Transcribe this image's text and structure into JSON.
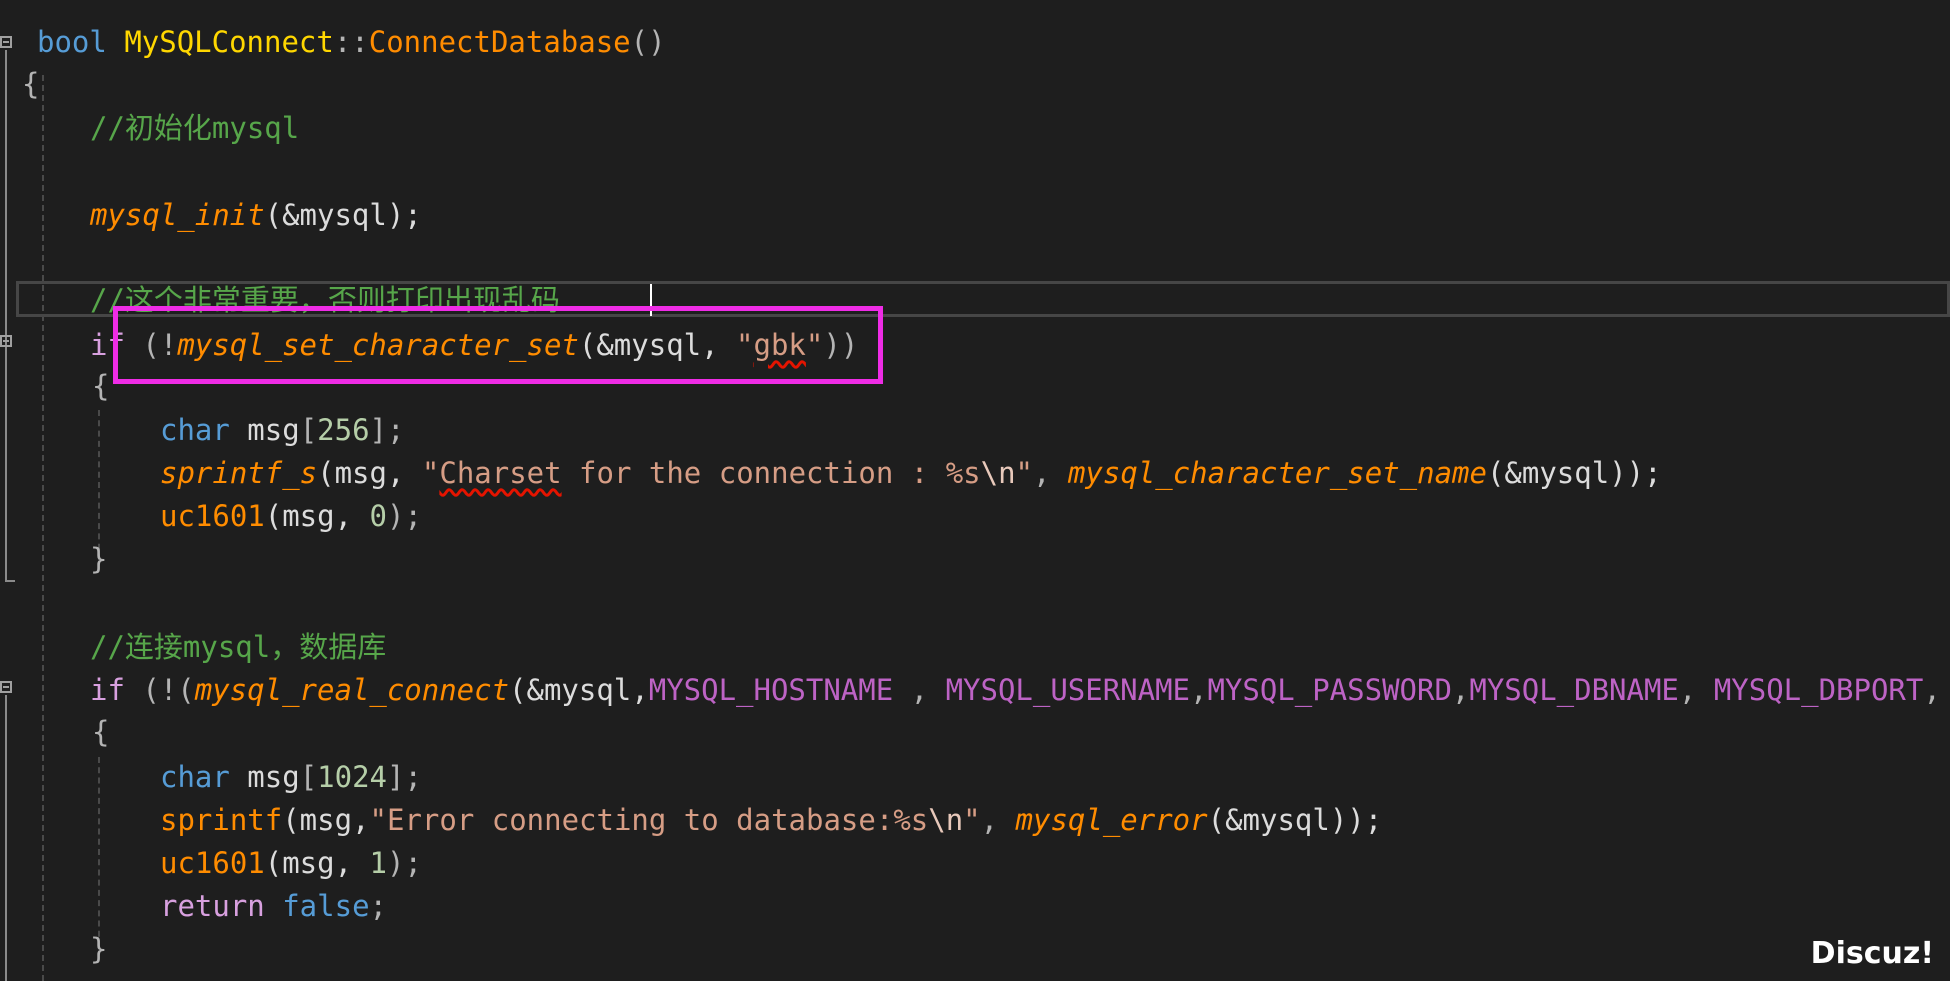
{
  "code": {
    "l1_bool": "bool",
    "l1_class": "MySQLConnect",
    "l1_scope": "::",
    "l1_fn": "ConnectDatabase",
    "l1_parens": "()",
    "l2_brace": "{",
    "l3_comment": "//初始化mysql",
    "l5_fn": "mysql_init",
    "l5_args": "(&mysql);",
    "l7_comment": "//这个非常重要，否则打印出现乱码",
    "l8_if": "if",
    "l8_open": " (!",
    "l8_fn": "mysql_set_character_set",
    "l8_args": "(&mysql, ",
    "l8_q1": "\"",
    "l8_str": "gbk",
    "l8_q2": "\"",
    "l8_close": "))",
    "l9_brace": "{",
    "l10_char": "char",
    "l10_var": " msg",
    "l10_lb": "[",
    "l10_num": "256",
    "l10_rb": "];",
    "l11_fn": "sprintf_s",
    "l11_a1": "(msg, ",
    "l11_q": "\"",
    "l11_word": "Charset",
    "l11_str": " for the connection : %s",
    "l11_esc": "\\n",
    "l11_q2": "\"",
    "l11_comma": ", ",
    "l11_fn2": "mysql_character_set_name",
    "l11_end": "(&mysql));",
    "l12_fn": "uc1601",
    "l12_args": "(msg, ",
    "l12_num": "0",
    "l12_end": ");",
    "l13_brace": "}",
    "l15_comment": "//连接mysql，数据库",
    "l16_if": "if",
    "l16_open": " (!(",
    "l16_fn": "mysql_real_connect",
    "l16_a1": "(&mysql,",
    "l16_m1": "MYSQL_HOSTNAME",
    "l16_c1": " , ",
    "l16_m2": "MYSQL_USERNAME",
    "l16_c2": ",",
    "l16_m3": "MYSQL_PASSWORD",
    "l16_c3": ",",
    "l16_m4": "MYSQL_DBNAME",
    "l16_c4": ", ",
    "l16_m5": "MYSQL_DBPORT",
    "l16_c5": ",",
    "l17_brace": "{",
    "l18_char": "char",
    "l18_var": " msg",
    "l18_lb": "[",
    "l18_num": "1024",
    "l18_rb": "];",
    "l19_fn": "sprintf",
    "l19_a1": "(msg,",
    "l19_str": "\"Error connecting to database:%s",
    "l19_esc": "\\n",
    "l19_q": "\"",
    "l19_comma": ", ",
    "l19_fn2": "mysql_error",
    "l19_end": "(&mysql));",
    "l20_fn": "uc1601",
    "l20_args": "(msg, ",
    "l20_num": "1",
    "l20_end": ");",
    "l21_return": "return",
    "l21_false": " false",
    "l21_semi": ";",
    "l22_brace": "}"
  },
  "watermark": "Discuz!",
  "colors": {
    "background": "#1e1e1e",
    "keyword": "#569cd6",
    "control_keyword": "#d8a0df",
    "function": "#ff8c00",
    "comment": "#57a64a",
    "string": "#d69d85",
    "macro": "#bd63c5",
    "number": "#b5cea8",
    "highlight_box": "#ef2ce6"
  }
}
